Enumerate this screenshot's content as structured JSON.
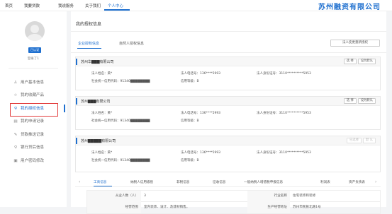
{
  "topnav": {
    "items": [
      "首页",
      "我要贷款",
      "我说服务",
      "关于我们",
      "个人中心"
    ],
    "active_index": 4,
    "brand": "苏州融资有限公司"
  },
  "sidebar": {
    "badge": "已认证",
    "username": "登录了1",
    "menu": [
      {
        "label": "用户基本信息",
        "icon": "user-icon"
      },
      {
        "label": "我的收藏产品",
        "icon": "star-icon"
      },
      {
        "label": "我的授权信息",
        "icon": "authorization-icon"
      },
      {
        "label": "我的申请记录",
        "icon": "record-icon"
      },
      {
        "label": "贷款推送记录",
        "icon": "edit-icon"
      },
      {
        "label": "银行贷后信息",
        "icon": "search-icon"
      },
      {
        "label": "用户密码修改",
        "icon": "lock-icon"
      }
    ],
    "active_index": 2
  },
  "main": {
    "title": "我的授权信息",
    "tabs": [
      "企业授权信息",
      "自然人授权信息"
    ],
    "active_tab": 0,
    "unbind_button": "法人变更重新授权",
    "cards": [
      {
        "company": "苏州华▇▇▇有限公司",
        "legal_name_label": "法人姓名：",
        "legal_name": "黄*",
        "phone_label": "法人电话号：",
        "phone": "136****5993",
        "id_label": "法人身份证号：",
        "id": "3110**********5953",
        "credit_code_label": "社会统一信用代码：",
        "credit_code": "91340▇▇▇▇▇▇▇▇",
        "level_label": "信用等级：",
        "level": "B",
        "buttons": [
          "选 择",
          "设为默认"
        ],
        "buttons_disabled": false
      },
      {
        "company": "苏州▇▇▇有限公司",
        "legal_name_label": "法人姓名：",
        "legal_name": "黄*",
        "phone_label": "法人电话号：",
        "phone": "136****5993",
        "id_label": "法人身份证号：",
        "id": "3110**********5953",
        "credit_code_label": "社会统一信用代码：",
        "credit_code": "91340▇▇▇▇▇▇▇▇",
        "level_label": "信用等级：",
        "level": "B",
        "buttons": [
          "选 择",
          "设为默认"
        ],
        "buttons_disabled": false
      },
      {
        "company": "苏州▇▇▇▇▇有限公司",
        "legal_name_label": "法人姓名：",
        "legal_name": "黄*",
        "phone_label": "法人电话号：",
        "phone": "136****5993",
        "id_label": "法人身份证号：",
        "id": "3110**********5953",
        "credit_code_label": "社会统一信用代码：",
        "credit_code": "91340▇▇▇▇▇▇▇▇",
        "level_label": "信用等级：",
        "level": "B",
        "buttons": [
          "已选择",
          "默 认"
        ],
        "buttons_disabled": true
      }
    ],
    "subtabs": [
      "工商信息",
      "纳税人信用级别",
      "非税信息",
      "征收信息",
      "一般纳税人增值税申报信息",
      "利润表",
      "资产负债表"
    ],
    "active_subtab": 0,
    "details": [
      {
        "label1": "从业人数（人）",
        "value1": "3",
        "label2": "行业名称",
        "value2": "住宅装饰和装修"
      },
      {
        "label1": "经营范围",
        "value1": "室内装饰、设计、及建材销售。",
        "label2": "生产经营地址",
        "value2": "苏州市民族北路1号"
      }
    ]
  }
}
